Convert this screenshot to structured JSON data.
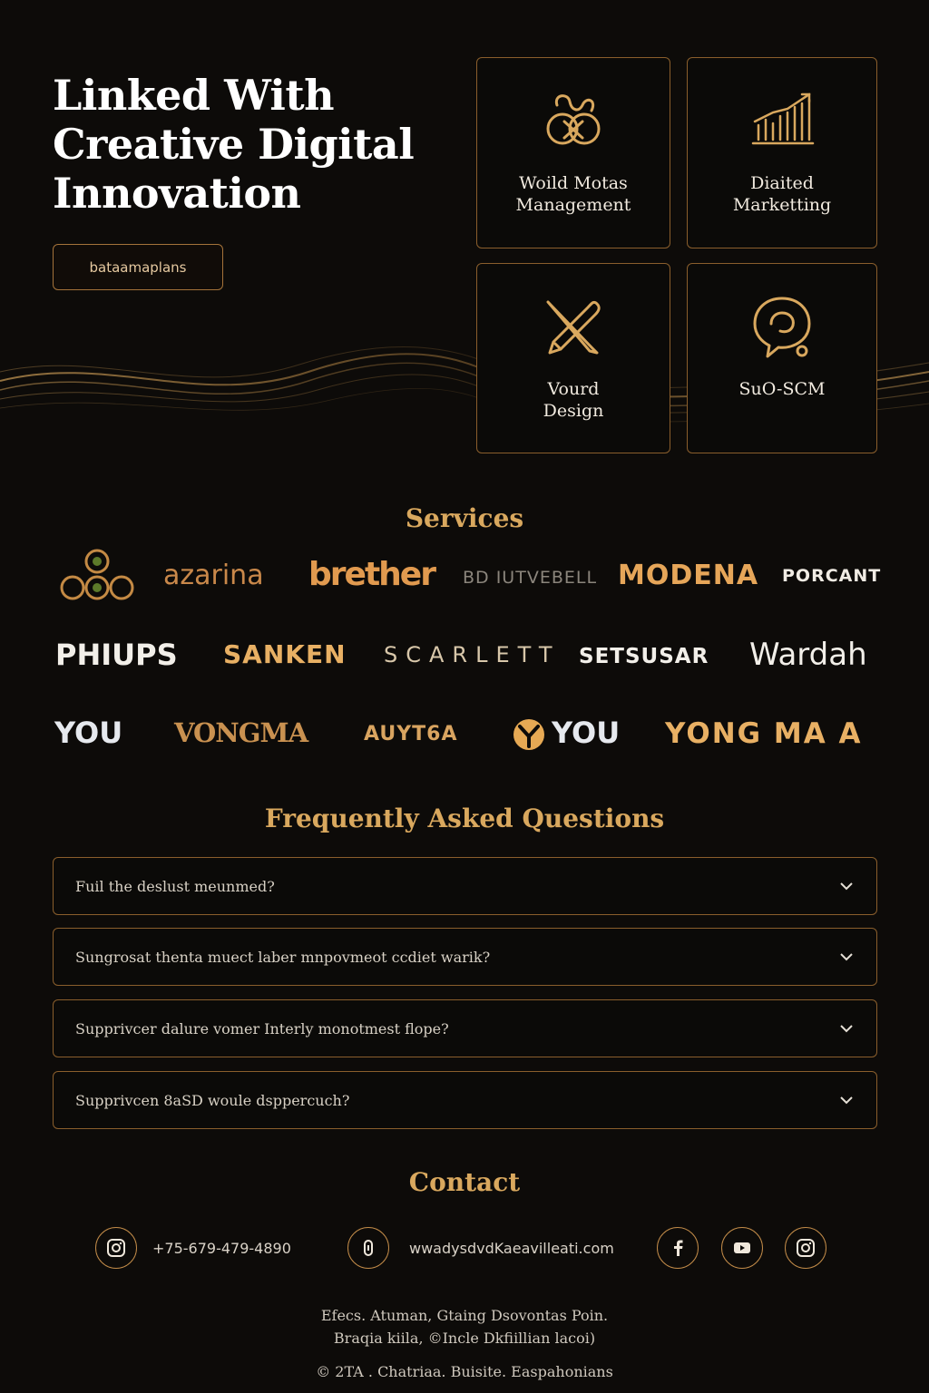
{
  "hero": {
    "title_lines": [
      "Linked With",
      "Creative Digital",
      "Innovation"
    ],
    "button_label": "bataamaplans"
  },
  "services_cards": [
    {
      "label": "Woild Motas\nManagement",
      "icon": "knot-icon"
    },
    {
      "label": "Diaited\nMarketting",
      "icon": "bar-chart-icon"
    },
    {
      "label": "Vourd\nDesign",
      "icon": "pencil-cross-icon"
    },
    {
      "label": "SuO-SCM",
      "icon": "chat-bubble-icon"
    }
  ],
  "sections": {
    "services_title": "Services",
    "faq_title": "Frequently Asked Questions",
    "contact_title": "Contact"
  },
  "logos": {
    "row1": [
      "azarina",
      "brether",
      "BD IUTVEBELL",
      "MODENA",
      "PORCANT"
    ],
    "row2": [
      "PHIUPS",
      "SANKEN",
      "SCARLETT",
      "SETSUSAR",
      "Wardah"
    ],
    "row3": [
      "YOU",
      "VONGMA",
      "AUYT6A",
      "YOU",
      "YONG MA A"
    ]
  },
  "faq": [
    "Fuil the deslust meunmed?",
    "Sungrosat thenta muect laber mnpovmeot ccdiet warik?",
    "Supprivcer dalure vomer Interly monotmest flope?",
    "Supprivcen 8aSD woule dsppercuch?"
  ],
  "contact": {
    "phone": "+75-679-479-4890",
    "website": "wwadysdvdKaeavilleati.com",
    "social_icons": [
      "facebook-icon",
      "youtube-icon",
      "instagram-icon"
    ]
  },
  "footer": {
    "address_line1": "Efecs. Atuman, Gtaing Dsovontas Poin.",
    "address_line2": "Braqia kiila, ©Incle Dkfiillian lacoi)",
    "copyright": "© 2TA . Chatriaa. Buisite. Easpahonians"
  },
  "colors": {
    "background": "#0d0b09",
    "accent_gold": "#d9a85e",
    "border_gold": "#8a5e2c"
  }
}
